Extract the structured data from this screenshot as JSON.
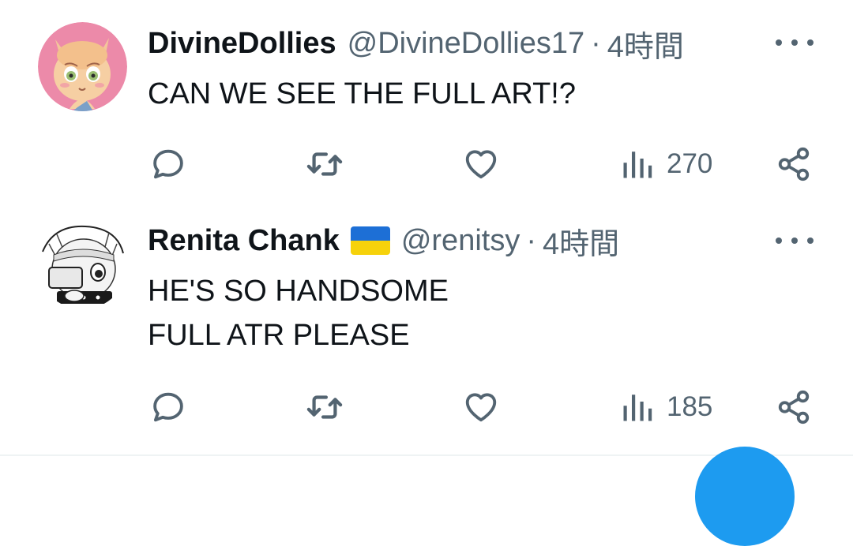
{
  "tweets": [
    {
      "name": "DivineDollies",
      "handle": "@DivineDollies17",
      "separator": "·",
      "time": "4時間",
      "lines": [
        "CAN WE SEE THE FULL ART!?"
      ],
      "views": "270",
      "avatar_icon": "fox-character-avatar",
      "has_flag": false
    },
    {
      "name": "Renita Chank",
      "handle": "@renitsy",
      "separator": "·",
      "time": "4時間",
      "lines": [
        "HE'S SO HANDSOME",
        "FULL ATR PLEASE"
      ],
      "views": "185",
      "avatar_icon": "sketch-character-avatar",
      "has_flag": true,
      "flag_icon": "ukraine-flag-icon"
    }
  ],
  "colors": {
    "text": "#0f1419",
    "secondary": "#536471",
    "accent": "#1d9bf0",
    "avatar1_bg": "#ec8aa9",
    "flag_blue": "#1d6fd6",
    "flag_yellow": "#f6d20b"
  },
  "icons": [
    "reply-icon",
    "retweet-icon",
    "like-icon",
    "views-icon",
    "share-icon",
    "more-icon"
  ]
}
